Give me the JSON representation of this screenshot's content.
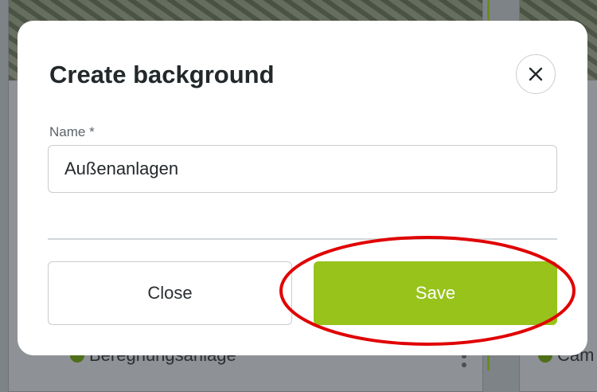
{
  "background": {
    "left_card_label": "Beregnungsanlage",
    "right_card_label": "Cam"
  },
  "modal": {
    "title": "Create background",
    "close_icon": "close-icon",
    "name_field": {
      "label": "Name *",
      "value": "Außenanlagen"
    },
    "close_button": "Close",
    "save_button": "Save"
  },
  "colors": {
    "accent": "#97c31b",
    "annotation": "#e00000"
  }
}
